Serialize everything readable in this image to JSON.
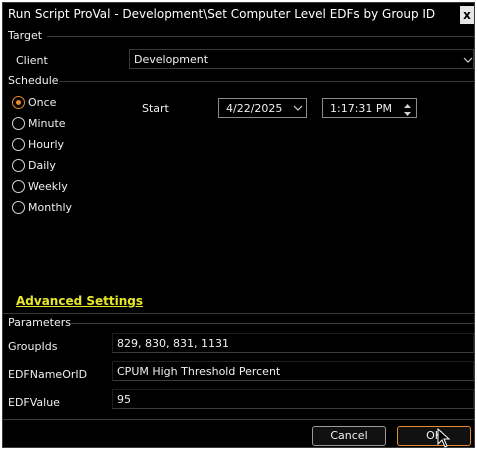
{
  "window": {
    "title": "Run Script ProVal - Development\\Set Computer Level EDFs by Group ID",
    "close_glyph": "x"
  },
  "target": {
    "section_label": "Target",
    "client_label": "Client",
    "client_value": "Development"
  },
  "schedule": {
    "section_label": "Schedule",
    "options": [
      {
        "label": "Once",
        "checked": true
      },
      {
        "label": "Minute",
        "checked": false
      },
      {
        "label": "Hourly",
        "checked": false
      },
      {
        "label": "Daily",
        "checked": false
      },
      {
        "label": "Weekly",
        "checked": false
      },
      {
        "label": "Monthly",
        "checked": false
      }
    ],
    "start_label": "Start",
    "start_date": "4/22/2025",
    "start_time": "1:17:31 PM"
  },
  "advanced_settings_label": "Advanced Settings",
  "parameters": {
    "section_label": "Parameters",
    "fields": [
      {
        "label": "GroupIds",
        "value": "829, 830, 831, 1131"
      },
      {
        "label": "EDFNameOrID",
        "value": "CPUM High Threshold Percent"
      },
      {
        "label": "EDFValue",
        "value": "95"
      }
    ]
  },
  "footer": {
    "cancel_label": "Cancel",
    "ok_label": "OK"
  },
  "colors": {
    "background": "#000000",
    "accent": "#e68a2e",
    "link": "#e8e82a",
    "border": "#3a3a3a"
  }
}
